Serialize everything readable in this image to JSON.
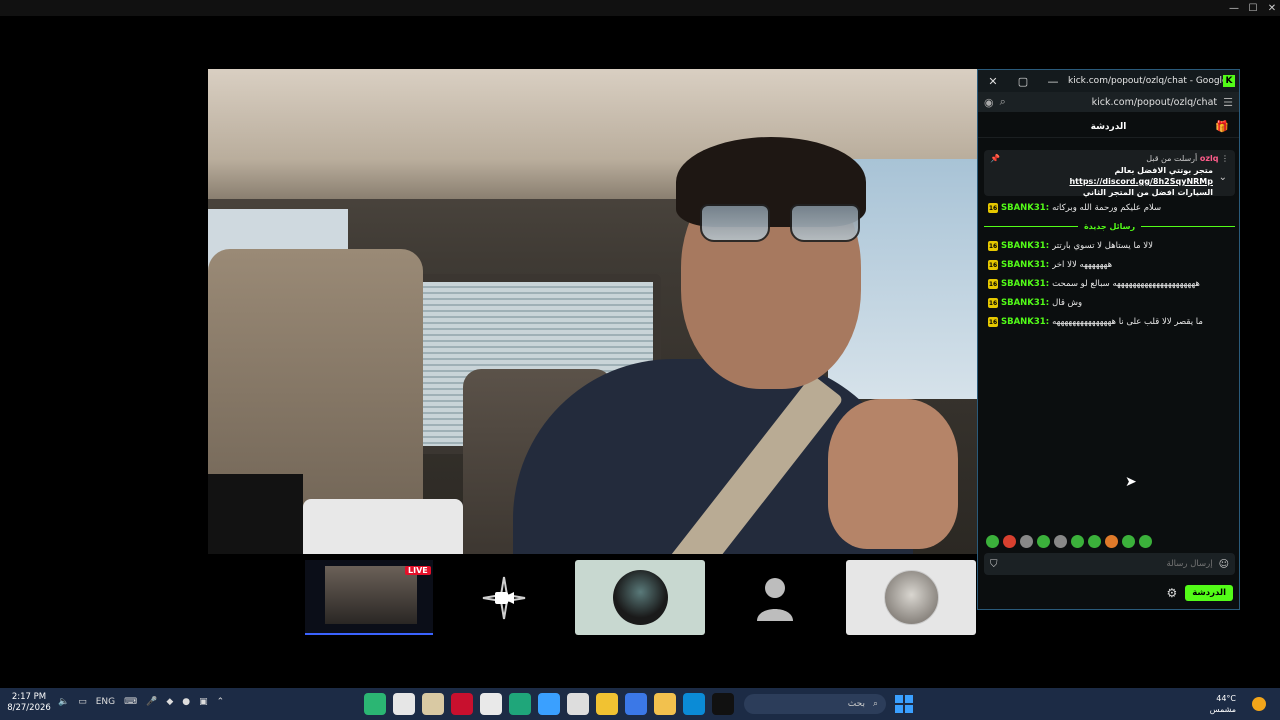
{
  "window": {
    "minimize": "—",
    "maximize": "☐",
    "close": "✕"
  },
  "tiles": {
    "live_badge": "LIVE"
  },
  "chat": {
    "titlebar": {
      "close": "✕",
      "maximize": "▢",
      "minimize": "—",
      "title": "kick.com/popout/ozlq/chat - Google Chr..."
    },
    "url": "kick.com/popout/ozlq/chat",
    "header": "الدردشة",
    "pinned": {
      "user": "ozlq",
      "sent_by_label": "أرسلت من قبل",
      "line1": "متجر بوتتي الافضل بعالم",
      "link": "https://discord.gg/8h2SqyNRMp",
      "line2": "السيارات افضل من المتجر الثاني"
    },
    "messages_before": [
      {
        "user": "SBANK31:",
        "text": "سلام عليكم ورحمة الله وبركاته"
      }
    ],
    "new_messages_label": "رسائل جديدة",
    "messages": [
      {
        "user": "SBANK31:",
        "text": "لالا ما يستاهل لا تسوي بارتتر"
      },
      {
        "user": "SBANK31:",
        "text": "هههههههه لالا اخر"
      },
      {
        "user": "SBANK31:",
        "text": "هههههههههههههههههههههه سبالع لو سمحت"
      },
      {
        "user": "SBANK31:",
        "text": "وش قال"
      },
      {
        "user": "SBANK31:",
        "text": "ما يقصر لالا قلب على نا هههههههههههههههه"
      }
    ],
    "input_placeholder": "إرسال رسالة",
    "send_label": "الدردشة",
    "badge_text": "16"
  },
  "taskbar": {
    "time": "2:17 PM",
    "date": "8/27/2026",
    "lang": "ENG",
    "search_placeholder": "بحث",
    "weather_temp": "44°C",
    "weather_desc": "مشمس"
  },
  "colors": {
    "kick_green": "#53fc18",
    "taskbar_bg": "#1c2b45",
    "chat_bg": "#0b0e0f"
  }
}
